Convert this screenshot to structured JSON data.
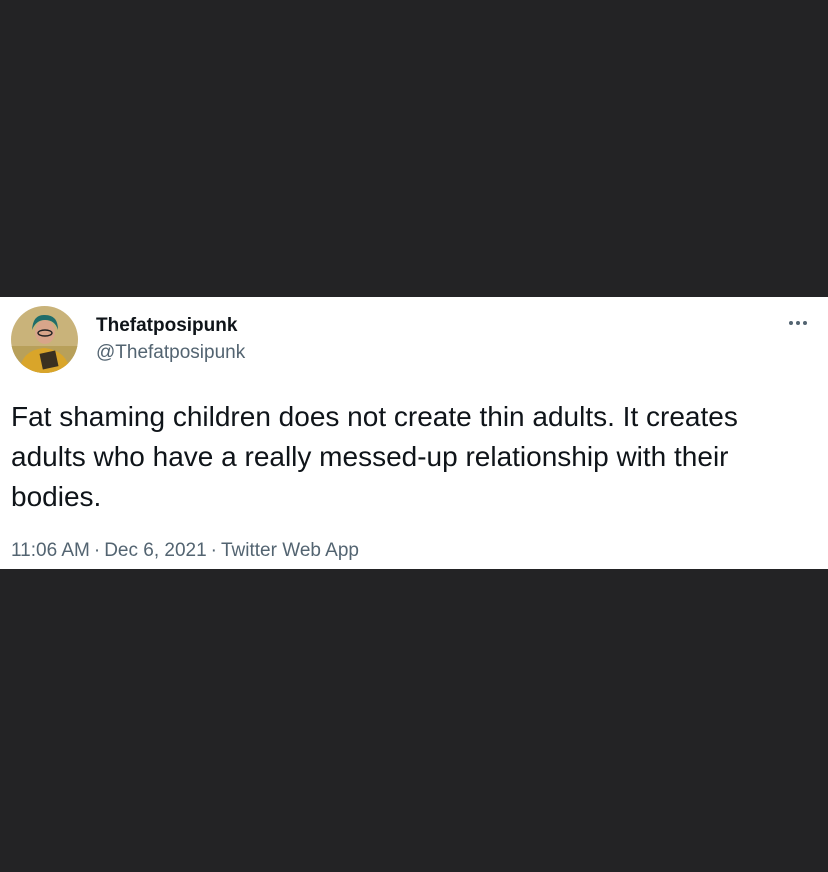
{
  "tweet": {
    "display_name": "Thefatposipunk",
    "handle": "@Thefatposipunk",
    "text": "Fat shaming children does not create thin adults. It creates adults who have a really messed-up relationship with their bodies.",
    "time": "11:06 AM",
    "date": "Dec 6, 2021",
    "source": "Twitter Web App",
    "separator": "·",
    "more_icon": "more-horizontal-icon",
    "avatar_icon": "profile-avatar-icon"
  },
  "colors": {
    "background": "#232325",
    "card": "#ffffff",
    "primary_text": "#0f1419",
    "secondary_text": "#536471"
  }
}
